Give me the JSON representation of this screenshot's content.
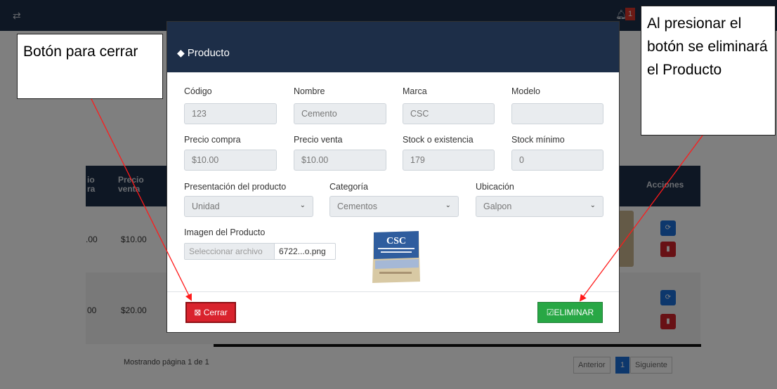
{
  "background": {
    "table_headers": [
      "io\nra",
      "Precio\nventa",
      "Acciones"
    ],
    "rows": [
      {
        "compra": ".00",
        "venta": "$10.00"
      },
      {
        "compra": "00",
        "venta": "$20.00"
      }
    ],
    "pagination_info": "Mostrando página 1 de 1",
    "pager": {
      "prev": "Anterior",
      "current": "1",
      "next": "Siguiente"
    },
    "notification_count": "1"
  },
  "modal": {
    "title": "Producto",
    "fields": {
      "codigo": {
        "label": "Código",
        "value": "123"
      },
      "nombre": {
        "label": "Nombre",
        "value": "Cemento"
      },
      "marca": {
        "label": "Marca",
        "value": "CSC"
      },
      "modelo": {
        "label": "Modelo",
        "value": ""
      },
      "precio_compra": {
        "label": "Precio compra",
        "value": "$10.00"
      },
      "precio_venta": {
        "label": "Precio venta",
        "value": "$10.00"
      },
      "stock": {
        "label": "Stock o existencia",
        "value": "179"
      },
      "stock_minimo": {
        "label": "Stock mínimo",
        "value": "0"
      },
      "presentacion": {
        "label": "Presentación del producto",
        "value": "Unidad"
      },
      "categoria": {
        "label": "Categoría",
        "value": "Cementos"
      },
      "ubicacion": {
        "label": "Ubicación",
        "value": "Galpon"
      },
      "imagen": {
        "label": "Imagen del Producto",
        "button": "Seleccionar archivo",
        "filename": "6722...o.png"
      }
    },
    "image_brand": "CSC",
    "buttons": {
      "cerrar": "Cerrar",
      "eliminar": "ELIMINAR"
    }
  },
  "callouts": {
    "left": "Botón para cerrar",
    "right": "Al presionar el botón se eliminará el Producto"
  },
  "colors": {
    "header": "#1d2e48",
    "danger": "#d9232d",
    "success": "#28a745",
    "primary": "#1b6fd9"
  }
}
